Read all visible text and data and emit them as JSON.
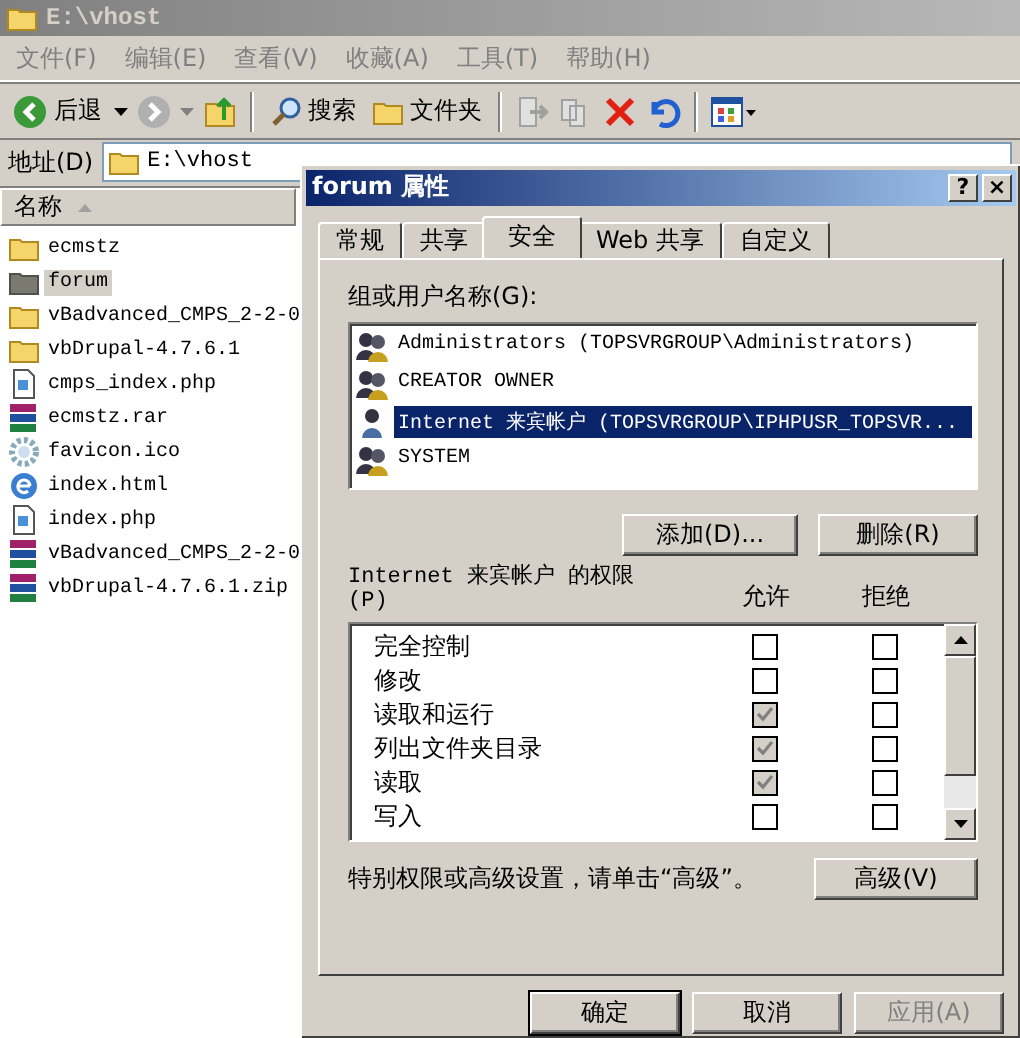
{
  "explorer": {
    "title": "E:\\vhost",
    "menu": [
      "文件(F)",
      "编辑(E)",
      "查看(V)",
      "收藏(A)",
      "工具(T)",
      "帮助(H)"
    ],
    "toolbar": {
      "back": "后退",
      "search": "搜索",
      "folders": "文件夹"
    },
    "address": {
      "label": "地址(D)",
      "value": "E:\\vhost"
    },
    "list": {
      "column": "名称",
      "files": [
        {
          "name": "ecmstz",
          "kind": "folder",
          "selected": false
        },
        {
          "name": "forum",
          "kind": "folder",
          "selected": true
        },
        {
          "name": "vBadvanced_CMPS_2-2-0",
          "kind": "folder",
          "selected": false
        },
        {
          "name": "vbDrupal-4.7.6.1",
          "kind": "folder",
          "selected": false
        },
        {
          "name": "cmps_index.php",
          "kind": "script",
          "selected": false
        },
        {
          "name": "ecmstz.rar",
          "kind": "archive",
          "selected": false
        },
        {
          "name": "favicon.ico",
          "kind": "gear",
          "selected": false
        },
        {
          "name": "index.html",
          "kind": "web",
          "selected": false
        },
        {
          "name": "index.php",
          "kind": "script",
          "selected": false
        },
        {
          "name": "vBadvanced_CMPS_2-2-0",
          "kind": "archive",
          "selected": false
        },
        {
          "name": "vbDrupal-4.7.6.1.zip",
          "kind": "archive",
          "selected": false
        }
      ]
    }
  },
  "dialog": {
    "title": "forum 属性",
    "title_buttons": [
      "?",
      "×"
    ],
    "tabs": [
      {
        "label": "常规",
        "selected": false
      },
      {
        "label": "共享",
        "selected": false
      },
      {
        "label": "安全",
        "selected": true
      },
      {
        "label": "Web 共享",
        "selected": false
      },
      {
        "label": "自定义",
        "selected": false
      }
    ],
    "users_label": "组或用户名称(G):",
    "users": [
      {
        "name": "Administrators (TOPSVRGROUP\\Administrators)",
        "kind": "group",
        "selected": false
      },
      {
        "name": "CREATOR OWNER",
        "kind": "group",
        "selected": false
      },
      {
        "name": "Internet 来宾帐户 (TOPSVRGROUP\\IPHPUSR_TOPSVR...",
        "kind": "user",
        "selected": true
      },
      {
        "name": "SYSTEM",
        "kind": "group",
        "selected": false
      }
    ],
    "add_button": "添加(D)...",
    "remove_button": "删除(R)",
    "permissions_label": [
      "Internet 来宾帐户 的权限",
      "(P)"
    ],
    "columns": [
      "允许",
      "拒绝"
    ],
    "permissions": [
      {
        "name": "完全控制",
        "allow": {
          "checked": false,
          "disabled": false
        },
        "deny": {
          "checked": false,
          "disabled": false
        }
      },
      {
        "name": "修改",
        "allow": {
          "checked": false,
          "disabled": false
        },
        "deny": {
          "checked": false,
          "disabled": false
        }
      },
      {
        "name": "读取和运行",
        "allow": {
          "checked": true,
          "disabled": true
        },
        "deny": {
          "checked": false,
          "disabled": false
        }
      },
      {
        "name": "列出文件夹目录",
        "allow": {
          "checked": true,
          "disabled": true
        },
        "deny": {
          "checked": false,
          "disabled": false
        }
      },
      {
        "name": "读取",
        "allow": {
          "checked": true,
          "disabled": true
        },
        "deny": {
          "checked": false,
          "disabled": false
        }
      },
      {
        "name": "写入",
        "allow": {
          "checked": false,
          "disabled": false
        },
        "deny": {
          "checked": false,
          "disabled": false
        }
      }
    ],
    "hint": "特别权限或高级设置，请单击“高级”。",
    "advanced_button": "高级(V)",
    "footer_buttons": [
      {
        "label": "确定",
        "disabled": false,
        "default": true
      },
      {
        "label": "取消",
        "disabled": false,
        "default": false
      },
      {
        "label": "应用(A)",
        "disabled": true,
        "default": false
      }
    ]
  }
}
